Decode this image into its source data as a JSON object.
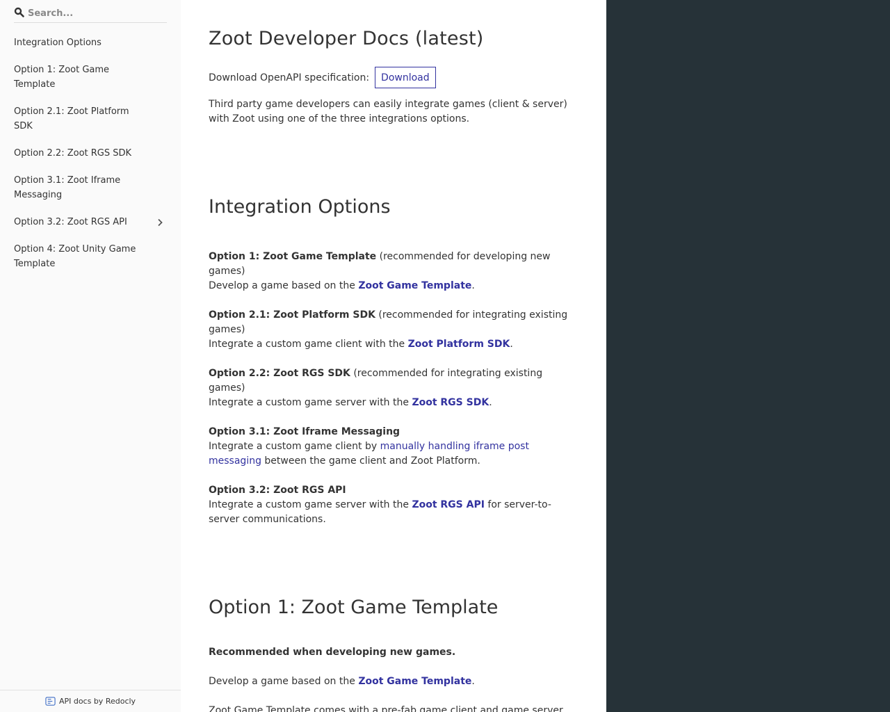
{
  "sidebar": {
    "search_placeholder": "Search...",
    "items": [
      {
        "label": "Integration Options"
      },
      {
        "label": "Option 1: Zoot Game Template"
      },
      {
        "label": "Option 2.1: Zoot Platform SDK"
      },
      {
        "label": "Option 2.2: Zoot RGS SDK"
      },
      {
        "label": "Option 3.1: Zoot Iframe Messaging"
      },
      {
        "label": "Option 3.2: Zoot RGS API",
        "expandable": true
      },
      {
        "label": "Option 4: Zoot Unity Game Template"
      }
    ],
    "footer": "API docs by Redocly"
  },
  "main": {
    "title": "Zoot Developer Docs (latest)",
    "download_label": "Download OpenAPI specification:",
    "download_button": "Download",
    "intro": "Third party game developers can easily integrate games (client & server) with Zoot using one of the three integrations options.",
    "integration_heading": "Integration Options",
    "options": [
      {
        "title": "Option 1: Zoot Game Template",
        "note": " (recommended for developing new games)",
        "pre": "Develop a game based on the ",
        "link": "Zoot Game Template",
        "post": "."
      },
      {
        "title": "Option 2.1: Zoot Platform SDK",
        "note": " (recommended for integrating existing games)",
        "pre": "Integrate a custom game client with the ",
        "link": "Zoot Platform SDK",
        "post": "."
      },
      {
        "title": "Option 2.2: Zoot RGS SDK",
        "note": " (recommended for integrating existing games)",
        "pre": "Integrate a custom game server with the ",
        "link": "Zoot RGS SDK",
        "post": "."
      },
      {
        "title": "Option 3.1: Zoot Iframe Messaging",
        "note": "",
        "pre": "Integrate a custom game client by ",
        "link": "manually handling iframe post messaging",
        "post": " between the game client and Zoot Platform."
      },
      {
        "title": "Option 3.2: Zoot RGS API",
        "note": "",
        "pre": "Integrate a custom game server with the ",
        "link": "Zoot RGS API",
        "post": " for server-to-server communications."
      }
    ],
    "option1_heading": "Option 1: Zoot Game Template",
    "option1_strong": "Recommended when developing new games.",
    "option1_pre": "Develop a game based on the ",
    "option1_link": "Zoot Game Template",
    "option1_post": ".",
    "option1_cut": "Zoot Game Template comes with a pre-fab game client and game server"
  },
  "colors": {
    "sidebar_bg": "#fafafa",
    "link": "#32329f",
    "right_panel": "#263238"
  }
}
